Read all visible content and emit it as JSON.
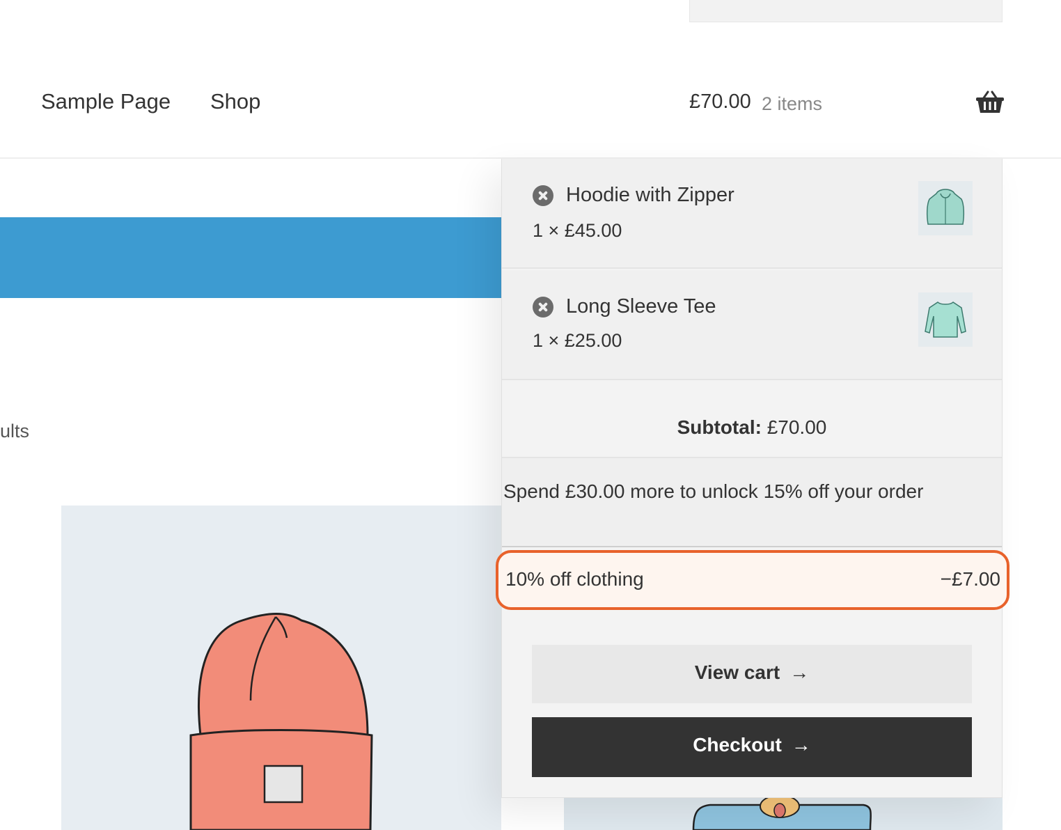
{
  "header": {
    "nav": [
      "Sample Page",
      "Shop"
    ],
    "cart_total": "£70.00",
    "cart_count": "2 items",
    "cart_icon": "basket-icon"
  },
  "page": {
    "results_fragment": "ults"
  },
  "mini_cart": {
    "items": [
      {
        "name": "Hoodie with Zipper",
        "qty_price": "1 × £45.00",
        "remove_icon": "remove-circle-icon",
        "thumb": "hoodie-thumbnail"
      },
      {
        "name": "Long Sleeve Tee",
        "qty_price": "1 × £25.00",
        "remove_icon": "remove-circle-icon",
        "thumb": "long-sleeve-tee-thumbnail"
      }
    ],
    "subtotal_label": "Subtotal:",
    "subtotal_value": "£70.00",
    "promo_message": "Spend £30.00 more to unlock 15% off your order",
    "discount": {
      "label": "10% off clothing",
      "amount": "−£7.00"
    },
    "view_cart_label": "View cart",
    "checkout_label": "Checkout",
    "arrow": "→"
  },
  "colors": {
    "accent_blue": "#3d9bd1",
    "highlight_orange": "#e8622b",
    "checkout_bg": "#333333"
  }
}
